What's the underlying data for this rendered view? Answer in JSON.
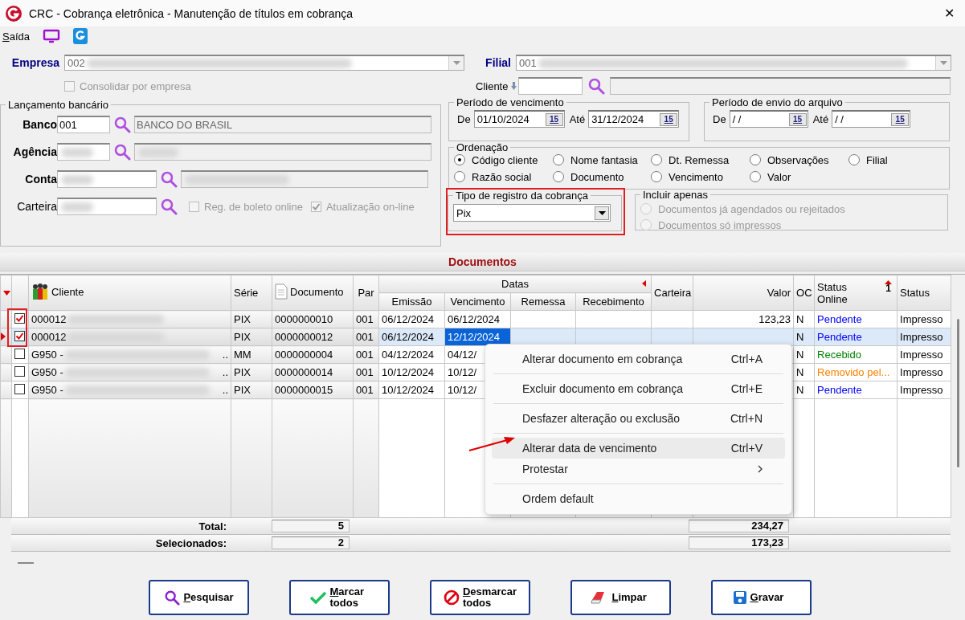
{
  "window": {
    "title": "CRC - Cobrança eletrônica - Manutenção de títulos em cobrança",
    "close": "✕"
  },
  "menu": {
    "label": "Saída"
  },
  "empresa": {
    "label": "Empresa",
    "value": "002"
  },
  "filial": {
    "label": "Filial",
    "value": "001"
  },
  "consolidar": {
    "label": "Consolidar por empresa",
    "checked": false,
    "disabled": true
  },
  "cliente": {
    "label": "Cliente"
  },
  "lancamento": {
    "title": "Lançamento bancário",
    "fields": [
      {
        "label": "Banco",
        "emphasized": true,
        "value": "001",
        "description": "BANCO DO BRASIL",
        "blurred": false
      },
      {
        "label": "Agência",
        "emphasized": true,
        "blurred": true
      },
      {
        "label": "Conta",
        "emphasized": true,
        "blurred": true
      },
      {
        "label": "Carteira",
        "emphasized": false,
        "blurred": true
      }
    ],
    "checks": [
      {
        "label": "Reg. de boleto online",
        "checked": false,
        "disabled": true
      },
      {
        "label": "Atualização on-line",
        "checked": true,
        "disabled": true
      }
    ]
  },
  "periodo_vencimento": {
    "title": "Período de vencimento",
    "fields": [
      {
        "label": "De",
        "value": "01/10/2024",
        "button": "15"
      },
      {
        "label": "Até",
        "value": "31/12/2024",
        "button": "15"
      }
    ]
  },
  "periodo_envio": {
    "title": "Período de envio do arquivo",
    "fields": [
      {
        "label": "De",
        "value": "/ /",
        "button": "15"
      },
      {
        "label": "Até",
        "value": "/ /",
        "button": "15"
      }
    ]
  },
  "ordenacao": {
    "title": "Ordenação",
    "options": [
      {
        "label": "Código cliente",
        "selected": true
      },
      {
        "label": "Nome fantasia",
        "selected": false
      },
      {
        "label": "Dt. Remessa",
        "selected": false
      },
      {
        "label": "Observações",
        "selected": false
      },
      {
        "label": "Filial",
        "selected": false
      },
      {
        "label": "Razão social",
        "selected": false
      },
      {
        "label": "Documento",
        "selected": false
      },
      {
        "label": "Vencimento",
        "selected": false
      },
      {
        "label": "Valor",
        "selected": false
      }
    ]
  },
  "tipo_registro": {
    "title": "Tipo de registro da cobrança",
    "value": "Pix",
    "highlighted": true
  },
  "incluir": {
    "title": "Incluir apenas",
    "options": [
      {
        "label": "Documentos já agendados ou rejeitados",
        "selected": false,
        "disabled": true
      },
      {
        "label": "Documentos só impressos",
        "selected": false,
        "disabled": true
      }
    ]
  },
  "documentos": {
    "title": "Documentos",
    "checks_highlighted": true,
    "header": {
      "cliente": "Cliente",
      "serie": "Série",
      "documento": "Documento",
      "par": "Par",
      "datas": "Datas",
      "emissao": "Emissão",
      "vencimento": "Vencimento",
      "remessa": "Remessa",
      "recebimento": "Recebimento",
      "carteira": "Carteira",
      "valor": "Valor",
      "oc": "OC",
      "status_online": "Status Online",
      "sort_order": "1",
      "status": "Status"
    },
    "rows": [
      {
        "checked": true,
        "current": false,
        "selected": false,
        "cliente": "000012",
        "serie": "PIX",
        "documento": "0000000010",
        "par": "001",
        "emissao": "06/12/2024",
        "vencimento": "06/12/2024",
        "valor": "123,23",
        "oc": "N",
        "status_online": "Pendente",
        "color": "#0000ff",
        "status": "Impresso"
      },
      {
        "checked": true,
        "current": true,
        "selected": true,
        "cliente": "000012",
        "serie": "PIX",
        "documento": "0000000012",
        "par": "001",
        "emissao": "06/12/2024",
        "vencimento": "12/12/2024",
        "oc": "N",
        "status_online": "Pendente",
        "color": "#0000ff",
        "status": "Impresso"
      },
      {
        "checked": false,
        "current": false,
        "selected": false,
        "cliente": "G950 -",
        "tail": "..",
        "serie": "MM",
        "documento": "0000000004",
        "par": "001",
        "emissao": "04/12/2024",
        "vencimento": "04/12/",
        "oc": "N",
        "status_online": "Recebido",
        "color": "#008000",
        "status": "Impresso"
      },
      {
        "checked": false,
        "current": false,
        "selected": false,
        "cliente": "G950 -",
        "tail": "..",
        "serie": "PIX",
        "documento": "0000000014",
        "par": "001",
        "emissao": "10/12/2024",
        "vencimento": "10/12/",
        "oc": "N",
        "status_online": "Removido pel...",
        "color": "#ff8000",
        "status": "Impresso"
      },
      {
        "checked": false,
        "current": false,
        "selected": false,
        "cliente": "G950 -",
        "tail": "..",
        "serie": "PIX",
        "documento": "0000000015",
        "par": "001",
        "emissao": "10/12/2024",
        "vencimento": "10/12/",
        "oc": "N",
        "status_online": "Pendente",
        "color": "#0000ff",
        "status": "Impresso"
      }
    ],
    "totals": [
      {
        "label": "Total:",
        "count": "5",
        "value": "234,27"
      },
      {
        "label": "Selecionados:",
        "count": "2",
        "value": "173,23"
      }
    ]
  },
  "context_menu": [
    {
      "kind": "item",
      "label": "Alterar documento em cobrança",
      "shortcut": "Ctrl+A",
      "hovered": false,
      "pointed": false
    },
    {
      "kind": "separator"
    },
    {
      "kind": "item",
      "label": "Excluir documento em cobrança",
      "shortcut": "Ctrl+E",
      "hovered": false,
      "pointed": false
    },
    {
      "kind": "separator"
    },
    {
      "kind": "item",
      "label": "Desfazer alteração ou exclusão",
      "shortcut": "Ctrl+N",
      "hovered": false,
      "pointed": false
    },
    {
      "kind": "separator"
    },
    {
      "kind": "item",
      "label": "Alterar data de vencimento",
      "shortcut": "Ctrl+V",
      "hovered": true,
      "pointed": true
    },
    {
      "kind": "submenu",
      "label": "Protestar",
      "hovered": false,
      "pointed": false
    },
    {
      "kind": "separator"
    },
    {
      "kind": "item",
      "label": "Ordem default",
      "hovered": false,
      "pointed": false
    }
  ],
  "buttons": [
    {
      "label": "Pesquisar",
      "kind": "search"
    },
    {
      "label": "Marcar todos",
      "kind": "check"
    },
    {
      "label": "Desmarcar todos",
      "kind": "forbidden"
    },
    {
      "label": "Limpar",
      "kind": "eraser"
    },
    {
      "label": "Gravar",
      "kind": "save"
    }
  ]
}
